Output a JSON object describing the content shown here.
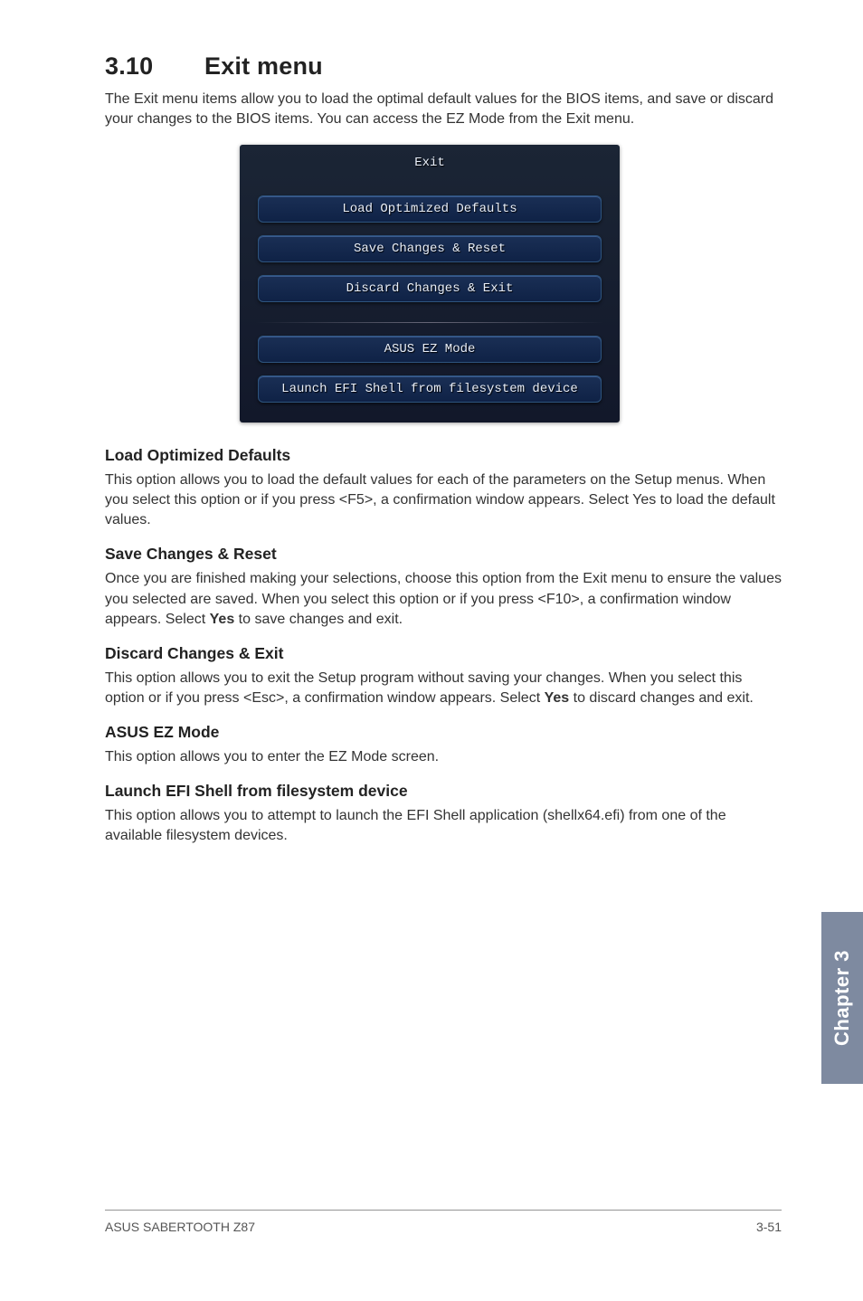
{
  "heading": {
    "number": "3.10",
    "title": "Exit menu"
  },
  "intro": "The Exit menu items allow you to load the optimal default values for the BIOS items, and save or discard your changes to the BIOS items. You can access the EZ Mode from the Exit menu.",
  "bios": {
    "title": "Exit",
    "buttons": {
      "load": "Load Optimized Defaults",
      "save": "Save Changes & Reset",
      "discard": "Discard Changes & Exit",
      "ez": "ASUS EZ Mode",
      "efi": "Launch EFI Shell from filesystem device"
    }
  },
  "sections": {
    "load": {
      "title": "Load Optimized Defaults",
      "body": "This option allows you to load the default values for each of the parameters on the Setup menus. When you select this option or if you press <F5>, a confirmation window appears. Select Yes to load the default values."
    },
    "save": {
      "title": "Save Changes & Reset",
      "body_a": "Once you are finished making your selections, choose this option from the Exit menu to ensure the values you selected are saved. When you select this option or if you press <F10>, a confirmation window appears. Select ",
      "body_yes": "Yes",
      "body_b": " to save changes and exit."
    },
    "discard": {
      "title": "Discard Changes & Exit",
      "body_a": "This option allows you to exit the Setup program without saving your changes. When you select this option or if you press <Esc>, a confirmation window appears. Select ",
      "body_yes": "Yes",
      "body_b": " to discard changes and exit."
    },
    "ez": {
      "title": "ASUS EZ Mode",
      "body": "This option allows you to enter the EZ Mode screen."
    },
    "efi": {
      "title": "Launch EFI Shell from filesystem device",
      "body": "This option allows you to attempt to launch the EFI Shell application (shellx64.efi) from one of the available filesystem devices."
    }
  },
  "side_tab": "Chapter 3",
  "footer": {
    "left": "ASUS SABERTOOTH Z87",
    "right": "3-51"
  }
}
